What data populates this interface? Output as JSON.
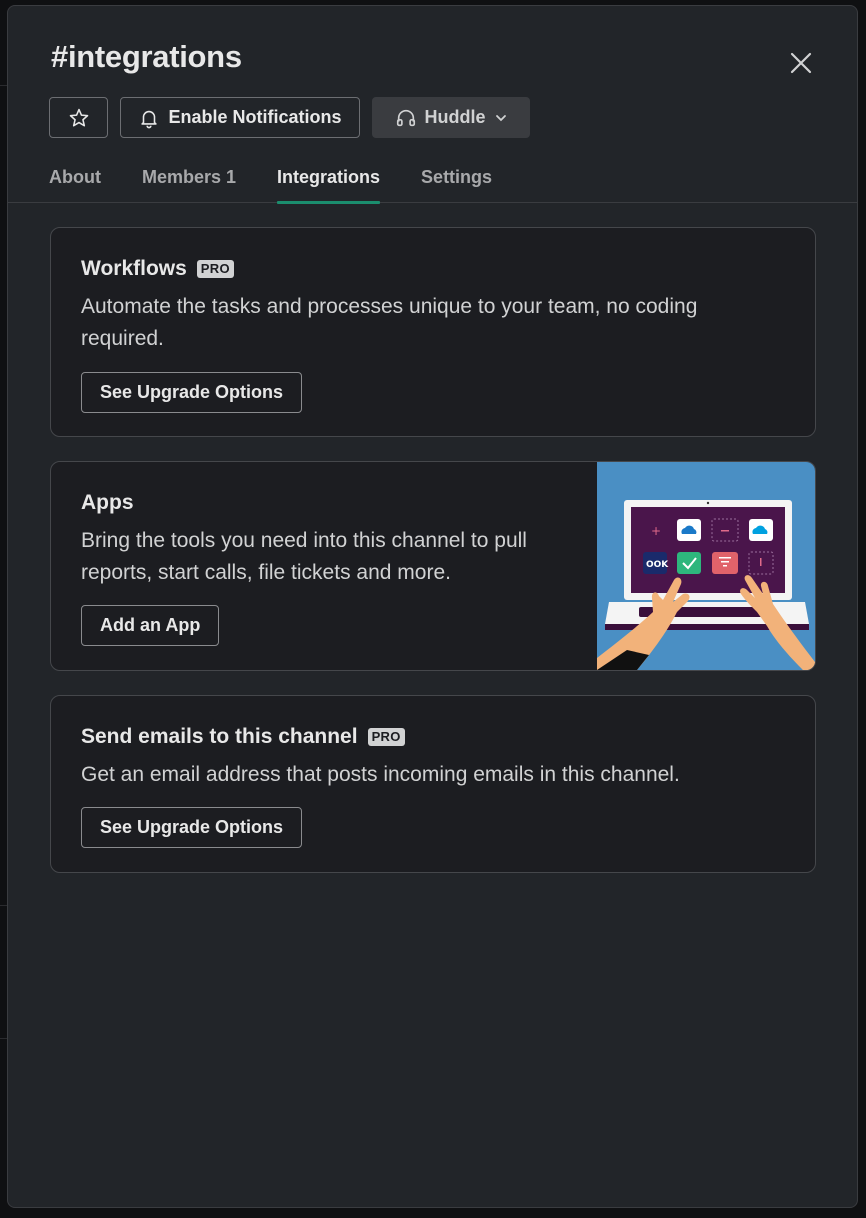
{
  "channel": {
    "hash": "#",
    "name": "integrations"
  },
  "toolbar": {
    "star_icon": "star-icon",
    "notifications_label": "Enable Notifications",
    "notifications_icon": "bell-icon",
    "huddle_label": "Huddle",
    "huddle_icon": "headphones-icon"
  },
  "tabs": [
    {
      "label": "About",
      "active": false
    },
    {
      "label": "Members 1",
      "active": false
    },
    {
      "label": "Integrations",
      "active": true
    },
    {
      "label": "Settings",
      "active": false
    }
  ],
  "cards": {
    "workflows": {
      "title": "Workflows",
      "badge": "PRO",
      "description_line1": "Automate the tasks and processes unique to your team, no coding",
      "description_line2": "required.",
      "button": "See Upgrade Options"
    },
    "apps": {
      "title": "Apps",
      "description_line1": "Bring the tools you need into this channel to pull",
      "description_line2": "reports, start calls, file tickets and more.",
      "button": "Add an App",
      "illustration_text": "OOK"
    },
    "email": {
      "title": "Send emails to this channel",
      "badge": "PRO",
      "description": "Get an email address that posts incoming emails in this channel.",
      "button": "See Upgrade Options"
    }
  },
  "colors": {
    "modal_bg": "#222529",
    "card_bg": "#1c1d21",
    "active_tab_underline": "#1b8e6e",
    "illustration_bg": "#4a8fc4",
    "laptop_screen": "#4a154b"
  }
}
